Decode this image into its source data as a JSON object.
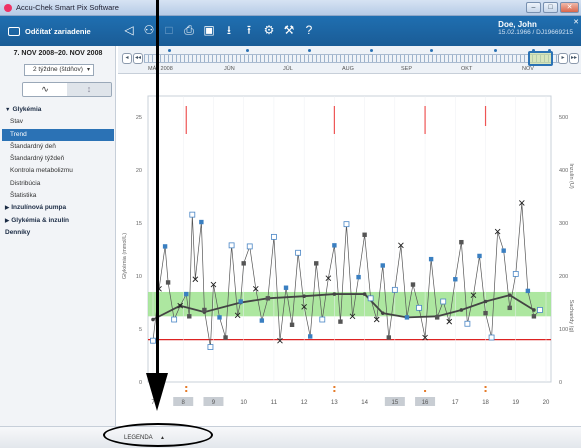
{
  "window": {
    "title": "Accu-Chek Smart Pix Software",
    "min": "–",
    "max": "□",
    "close": "✕"
  },
  "toolbar": {
    "read_device": "Odčítať zariadenie"
  },
  "patient": {
    "name": "Doe, John",
    "dob_id": "15.02.1966 / DJ19669215",
    "close": "✕"
  },
  "left": {
    "date_range": "7. NOV 2008–20. NOV 2008",
    "period": "2 týždne (štdňov)",
    "toggle": [
      "∿",
      "↕"
    ],
    "nav": [
      {
        "label": "Glykémia",
        "type": "section",
        "open": true
      },
      {
        "label": "Stav",
        "type": "item"
      },
      {
        "label": "Trend",
        "type": "item",
        "selected": true
      },
      {
        "label": "Štandardný deň",
        "type": "item"
      },
      {
        "label": "Štandardný týždeň",
        "type": "item"
      },
      {
        "label": "Kontrola metabolizmu",
        "type": "item"
      },
      {
        "label": "Distribúcia",
        "type": "item"
      },
      {
        "label": "Štatistika",
        "type": "item"
      },
      {
        "label": "Inzulínová pumpa",
        "type": "section",
        "open": false
      },
      {
        "label": "Glykémia & inzulín",
        "type": "section",
        "open": false
      },
      {
        "label": "Denníky",
        "type": "section-plain"
      }
    ]
  },
  "timeline": {
    "months": [
      "MÁJ 2008",
      "JÚN",
      "JÚL",
      "AUG",
      "SEP",
      "OKT",
      "NOV"
    ],
    "nav_buttons": [
      "◂",
      "◂◂",
      "▸",
      "▸▸"
    ]
  },
  "chart_data": {
    "type": "scatter",
    "ylabel_left": "Glykémia (mmol/L)",
    "ylabel_right_top": "Inzulín (U)",
    "ylabel_right_bottom": "Sacharidy (g)",
    "yticks_left": [
      0,
      5,
      10,
      15,
      20,
      25
    ],
    "yticks_right": [
      0,
      100,
      200,
      300,
      400,
      500
    ],
    "ylim": [
      0,
      27
    ],
    "target_range": [
      6.2,
      8.5
    ],
    "hypo_line": 4.0,
    "x_ticks": [
      "7",
      "8",
      "9",
      "10",
      "11",
      "12",
      "13",
      "14",
      "15",
      "16",
      "17",
      "18",
      "19",
      "20"
    ],
    "x_highlight": [
      "8",
      "9",
      "15",
      "16"
    ],
    "readings": [
      [
        7.0,
        3.9
      ],
      [
        7.2,
        8.8
      ],
      [
        7.4,
        12.8
      ],
      [
        7.5,
        9.4
      ],
      [
        7.7,
        5.9
      ],
      [
        7.9,
        7.2
      ],
      [
        8.1,
        8.3
      ],
      [
        8.2,
        6.2
      ],
      [
        8.3,
        15.8
      ],
      [
        8.4,
        9.7
      ],
      [
        8.6,
        15.1
      ],
      [
        8.7,
        6.8
      ],
      [
        8.9,
        3.3
      ],
      [
        9.0,
        9.2
      ],
      [
        9.2,
        6.1
      ],
      [
        9.4,
        4.2
      ],
      [
        9.6,
        12.9
      ],
      [
        9.8,
        6.3
      ],
      [
        9.9,
        7.6
      ],
      [
        10.0,
        11.2
      ],
      [
        10.2,
        12.8
      ],
      [
        10.4,
        8.8
      ],
      [
        10.6,
        5.8
      ],
      [
        10.8,
        7.9
      ],
      [
        11.0,
        13.7
      ],
      [
        11.2,
        3.9
      ],
      [
        11.4,
        8.9
      ],
      [
        11.6,
        5.4
      ],
      [
        11.8,
        12.2
      ],
      [
        12.0,
        7.1
      ],
      [
        12.2,
        4.3
      ],
      [
        12.4,
        11.2
      ],
      [
        12.6,
        5.9
      ],
      [
        12.8,
        9.8
      ],
      [
        13.0,
        12.9
      ],
      [
        13.2,
        5.7
      ],
      [
        13.4,
        14.9
      ],
      [
        13.6,
        6.2
      ],
      [
        13.8,
        9.9
      ],
      [
        14.0,
        13.9
      ],
      [
        14.2,
        7.9
      ],
      [
        14.4,
        5.9
      ],
      [
        14.6,
        11.0
      ],
      [
        14.8,
        4.2
      ],
      [
        15.0,
        8.7
      ],
      [
        15.2,
        12.9
      ],
      [
        15.4,
        6.1
      ],
      [
        15.6,
        9.2
      ],
      [
        15.8,
        7.0
      ],
      [
        16.0,
        4.2
      ],
      [
        16.2,
        11.6
      ],
      [
        16.4,
        6.1
      ],
      [
        16.6,
        7.6
      ],
      [
        16.8,
        5.7
      ],
      [
        17.0,
        9.7
      ],
      [
        17.2,
        13.2
      ],
      [
        17.4,
        5.5
      ],
      [
        17.6,
        8.2
      ],
      [
        17.8,
        11.9
      ],
      [
        18.0,
        6.5
      ],
      [
        18.2,
        4.2
      ],
      [
        18.4,
        14.2
      ],
      [
        18.6,
        12.4
      ],
      [
        18.8,
        7.0
      ],
      [
        19.0,
        10.2
      ],
      [
        19.2,
        16.9
      ],
      [
        19.4,
        8.6
      ],
      [
        19.6,
        6.2
      ],
      [
        19.8,
        6.8
      ]
    ],
    "trend": [
      [
        7.0,
        5.9
      ],
      [
        7.9,
        7.2
      ],
      [
        8.7,
        6.6
      ],
      [
        9.9,
        7.5
      ],
      [
        10.8,
        7.9
      ],
      [
        12.0,
        8.1
      ],
      [
        13.0,
        8.3
      ],
      [
        14.0,
        8.3
      ],
      [
        14.6,
        6.5
      ],
      [
        15.4,
        6.1
      ],
      [
        16.4,
        6.2
      ],
      [
        17.2,
        6.8
      ],
      [
        18.0,
        7.6
      ],
      [
        18.8,
        8.2
      ],
      [
        19.6,
        6.8
      ]
    ],
    "insulin_bars_top": [
      [
        8.1,
        3.5
      ],
      [
        13.0,
        3.5
      ],
      [
        16.0,
        3.5
      ],
      [
        18.0,
        2.5
      ]
    ],
    "carb_marks": [
      [
        8.1,
        2
      ],
      [
        13.0,
        2
      ],
      [
        16.0,
        1
      ],
      [
        18.0,
        2
      ]
    ]
  },
  "bottom": {
    "legend": "LEGENDA",
    "legend_arrow": "▲"
  }
}
